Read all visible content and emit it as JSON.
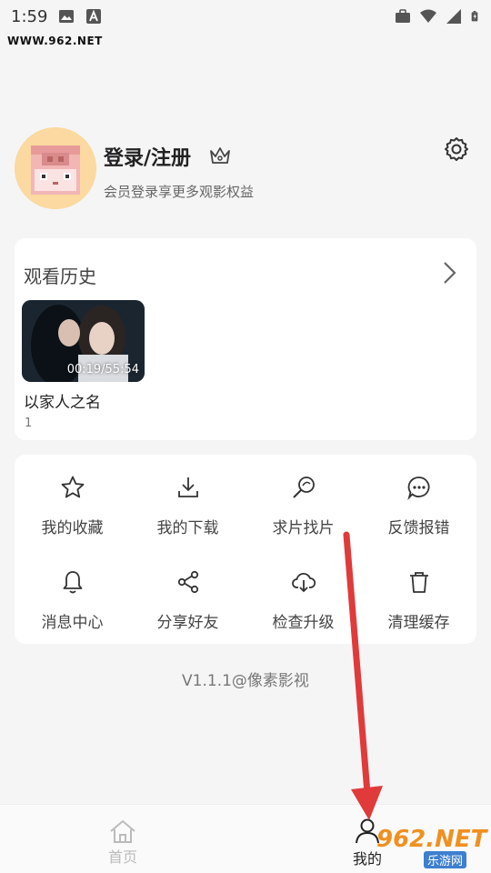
{
  "status_bar": {
    "time": "1:59"
  },
  "watermark_top": "WWW.962.NET",
  "profile": {
    "title": "登录/注册",
    "subtitle": "会员登录享更多观影权益"
  },
  "history": {
    "title": "观看历史",
    "items": [
      {
        "name": "以家人之名",
        "time": "00:19/55:54",
        "episode": "1"
      }
    ]
  },
  "menu": [
    {
      "label": "我的收藏",
      "icon": "star-icon"
    },
    {
      "label": "我的下载",
      "icon": "download-icon"
    },
    {
      "label": "求片找片",
      "icon": "search-icon"
    },
    {
      "label": "反馈报错",
      "icon": "chat-icon"
    },
    {
      "label": "消息中心",
      "icon": "bell-icon"
    },
    {
      "label": "分享好友",
      "icon": "share-icon"
    },
    {
      "label": "检查升级",
      "icon": "cloud-download-icon"
    },
    {
      "label": "清理缓存",
      "icon": "trash-icon"
    }
  ],
  "version": "V1.1.1@像素影视",
  "nav": {
    "home": "首页",
    "mine": "我的"
  },
  "watermark_bottom": {
    "big": "962.NET",
    "small": "乐游网"
  },
  "colors": {
    "accent_arrow": "#e03a3a",
    "avatar_bg": "#fbd9a0"
  }
}
